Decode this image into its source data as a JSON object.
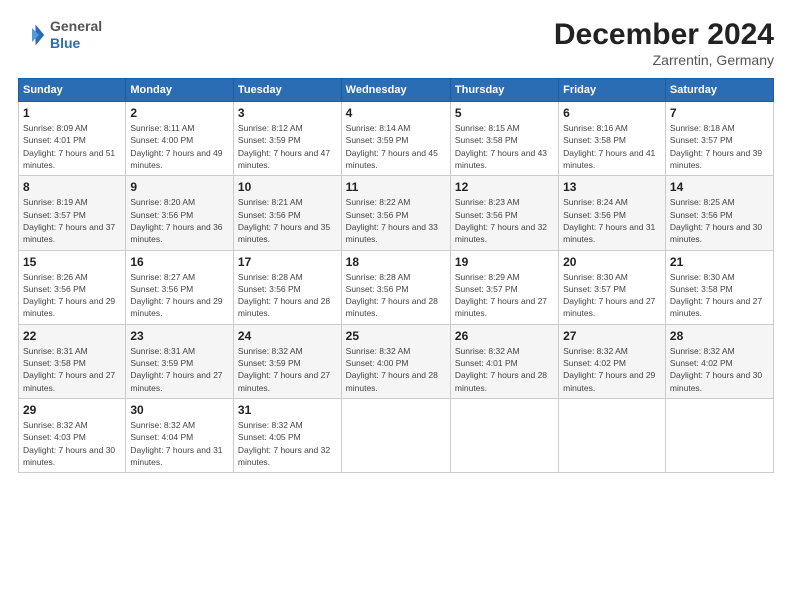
{
  "header": {
    "logo_line1": "General",
    "logo_line2": "Blue",
    "month_title": "December 2024",
    "location": "Zarrentin, Germany"
  },
  "days_of_week": [
    "Sunday",
    "Monday",
    "Tuesday",
    "Wednesday",
    "Thursday",
    "Friday",
    "Saturday"
  ],
  "weeks": [
    [
      {
        "day": 1,
        "sunrise": "8:09 AM",
        "sunset": "4:01 PM",
        "daylight": "7 hours and 51 minutes."
      },
      {
        "day": 2,
        "sunrise": "8:11 AM",
        "sunset": "4:00 PM",
        "daylight": "7 hours and 49 minutes."
      },
      {
        "day": 3,
        "sunrise": "8:12 AM",
        "sunset": "3:59 PM",
        "daylight": "7 hours and 47 minutes."
      },
      {
        "day": 4,
        "sunrise": "8:14 AM",
        "sunset": "3:59 PM",
        "daylight": "7 hours and 45 minutes."
      },
      {
        "day": 5,
        "sunrise": "8:15 AM",
        "sunset": "3:58 PM",
        "daylight": "7 hours and 43 minutes."
      },
      {
        "day": 6,
        "sunrise": "8:16 AM",
        "sunset": "3:58 PM",
        "daylight": "7 hours and 41 minutes."
      },
      {
        "day": 7,
        "sunrise": "8:18 AM",
        "sunset": "3:57 PM",
        "daylight": "7 hours and 39 minutes."
      }
    ],
    [
      {
        "day": 8,
        "sunrise": "8:19 AM",
        "sunset": "3:57 PM",
        "daylight": "7 hours and 37 minutes."
      },
      {
        "day": 9,
        "sunrise": "8:20 AM",
        "sunset": "3:56 PM",
        "daylight": "7 hours and 36 minutes."
      },
      {
        "day": 10,
        "sunrise": "8:21 AM",
        "sunset": "3:56 PM",
        "daylight": "7 hours and 35 minutes."
      },
      {
        "day": 11,
        "sunrise": "8:22 AM",
        "sunset": "3:56 PM",
        "daylight": "7 hours and 33 minutes."
      },
      {
        "day": 12,
        "sunrise": "8:23 AM",
        "sunset": "3:56 PM",
        "daylight": "7 hours and 32 minutes."
      },
      {
        "day": 13,
        "sunrise": "8:24 AM",
        "sunset": "3:56 PM",
        "daylight": "7 hours and 31 minutes."
      },
      {
        "day": 14,
        "sunrise": "8:25 AM",
        "sunset": "3:56 PM",
        "daylight": "7 hours and 30 minutes."
      }
    ],
    [
      {
        "day": 15,
        "sunrise": "8:26 AM",
        "sunset": "3:56 PM",
        "daylight": "7 hours and 29 minutes."
      },
      {
        "day": 16,
        "sunrise": "8:27 AM",
        "sunset": "3:56 PM",
        "daylight": "7 hours and 29 minutes."
      },
      {
        "day": 17,
        "sunrise": "8:28 AM",
        "sunset": "3:56 PM",
        "daylight": "7 hours and 28 minutes."
      },
      {
        "day": 18,
        "sunrise": "8:28 AM",
        "sunset": "3:56 PM",
        "daylight": "7 hours and 28 minutes."
      },
      {
        "day": 19,
        "sunrise": "8:29 AM",
        "sunset": "3:57 PM",
        "daylight": "7 hours and 27 minutes."
      },
      {
        "day": 20,
        "sunrise": "8:30 AM",
        "sunset": "3:57 PM",
        "daylight": "7 hours and 27 minutes."
      },
      {
        "day": 21,
        "sunrise": "8:30 AM",
        "sunset": "3:58 PM",
        "daylight": "7 hours and 27 minutes."
      }
    ],
    [
      {
        "day": 22,
        "sunrise": "8:31 AM",
        "sunset": "3:58 PM",
        "daylight": "7 hours and 27 minutes."
      },
      {
        "day": 23,
        "sunrise": "8:31 AM",
        "sunset": "3:59 PM",
        "daylight": "7 hours and 27 minutes."
      },
      {
        "day": 24,
        "sunrise": "8:32 AM",
        "sunset": "3:59 PM",
        "daylight": "7 hours and 27 minutes."
      },
      {
        "day": 25,
        "sunrise": "8:32 AM",
        "sunset": "4:00 PM",
        "daylight": "7 hours and 28 minutes."
      },
      {
        "day": 26,
        "sunrise": "8:32 AM",
        "sunset": "4:01 PM",
        "daylight": "7 hours and 28 minutes."
      },
      {
        "day": 27,
        "sunrise": "8:32 AM",
        "sunset": "4:02 PM",
        "daylight": "7 hours and 29 minutes."
      },
      {
        "day": 28,
        "sunrise": "8:32 AM",
        "sunset": "4:02 PM",
        "daylight": "7 hours and 30 minutes."
      }
    ],
    [
      {
        "day": 29,
        "sunrise": "8:32 AM",
        "sunset": "4:03 PM",
        "daylight": "7 hours and 30 minutes."
      },
      {
        "day": 30,
        "sunrise": "8:32 AM",
        "sunset": "4:04 PM",
        "daylight": "7 hours and 31 minutes."
      },
      {
        "day": 31,
        "sunrise": "8:32 AM",
        "sunset": "4:05 PM",
        "daylight": "7 hours and 32 minutes."
      },
      null,
      null,
      null,
      null
    ]
  ]
}
